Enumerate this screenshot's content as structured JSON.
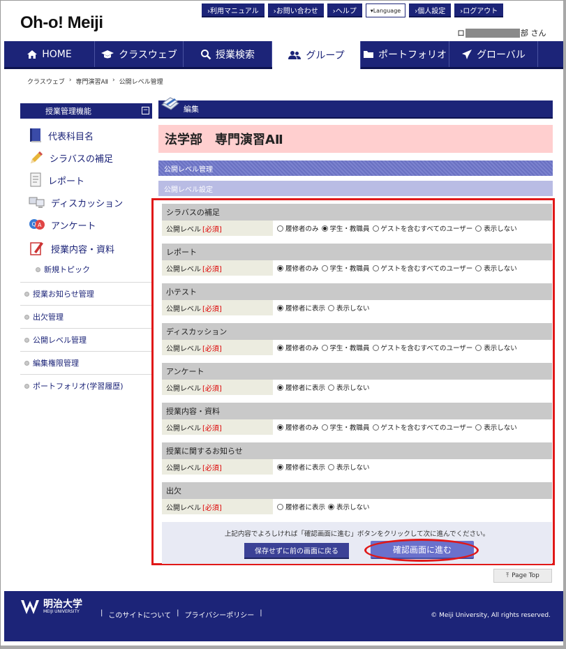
{
  "header": {
    "logo": "Oh-o! Meiji",
    "top_links": [
      "›利用マニュアル",
      "›お問い合わせ",
      "›ヘルプ",
      "▾Language",
      "›個人設定",
      "›ログアウト"
    ],
    "user_prefix": "ロ",
    "user_suffix": "部 さん"
  },
  "nav": {
    "items": [
      "HOME",
      "クラスウェブ",
      "授業検索",
      "グループ",
      "ポートフォリオ",
      "グローバル"
    ],
    "active": "グループ"
  },
  "breadcrumb": [
    "クラスウェブ",
    "›",
    "専門演習AⅡ",
    "›",
    "公開レベル管理"
  ],
  "sidebar": {
    "title": "授業管理機能",
    "toggle": "−",
    "icon_items": [
      "代表科目名",
      "シラバスの補足",
      "レポート",
      "ディスカッション",
      "アンケート",
      "授業内容・資料"
    ],
    "sub_item": "新規トピック",
    "plain_items": [
      "授業お知らせ管理",
      "出欠管理",
      "公開レベル管理",
      "編集権限管理",
      "ポートフォリオ(学習履歴)"
    ]
  },
  "main": {
    "edit_label": "編集",
    "course_title": "法学部　専門演習AⅡ",
    "section1": "公開レベル管理",
    "section2": "公開レベル設定",
    "level_label": "公開レベル",
    "required_label": "[必須]",
    "blocks": [
      {
        "title": "シラバスの補足",
        "options": [
          "履修者のみ",
          "学生・教職員",
          "ゲストを含むすべてのユーザー",
          "表示しない"
        ],
        "selected": 1
      },
      {
        "title": "レポート",
        "options": [
          "履修者のみ",
          "学生・教職員",
          "ゲストを含むすべてのユーザー",
          "表示しない"
        ],
        "selected": 0
      },
      {
        "title": "小テスト",
        "options": [
          "履修者に表示",
          "表示しない"
        ],
        "selected": 0
      },
      {
        "title": "ディスカッション",
        "options": [
          "履修者のみ",
          "学生・教職員",
          "ゲストを含むすべてのユーザー",
          "表示しない"
        ],
        "selected": 0
      },
      {
        "title": "アンケート",
        "options": [
          "履修者に表示",
          "表示しない"
        ],
        "selected": 0
      },
      {
        "title": "授業内容・資料",
        "options": [
          "履修者のみ",
          "学生・教職員",
          "ゲストを含むすべてのユーザー",
          "表示しない"
        ],
        "selected": 0
      },
      {
        "title": "授業に関するお知らせ",
        "options": [
          "履修者に表示",
          "表示しない"
        ],
        "selected": 0
      },
      {
        "title": "出欠",
        "options": [
          "履修者に表示",
          "表示しない"
        ],
        "selected": 1
      }
    ],
    "confirm_message": "上記内容でよろしければ「確認画面に進む」ボタンをクリックして次に進んでください。",
    "back_button": "保存せずに前の画面に戻る",
    "next_button": "確認画面に進む"
  },
  "page_top": "Page Top",
  "footer": {
    "university": "明治大学",
    "university_en": "MEIJI UNIVERSITY",
    "links": [
      "|",
      "このサイトについて",
      "|",
      "プライバシーポリシー",
      "|"
    ],
    "copyright": "© Meiji University, All rights reserved."
  },
  "colors": {
    "navy": "#1c2478",
    "highlight_red": "#e01818",
    "title_pink": "#ffcfcf"
  }
}
